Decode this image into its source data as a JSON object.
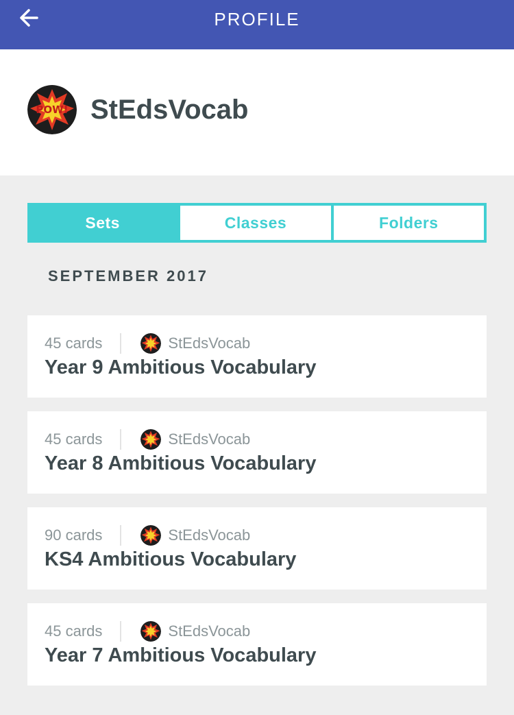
{
  "header": {
    "title": "PROFILE",
    "back_icon": "arrow-left-icon"
  },
  "profile": {
    "username": "StEdsVocab",
    "avatar_icon": "pow-comic-avatar",
    "avatar_text": "POW!"
  },
  "tabs": [
    {
      "label": "Sets",
      "active": true
    },
    {
      "label": "Classes",
      "active": false
    },
    {
      "label": "Folders",
      "active": false
    }
  ],
  "section": {
    "heading": "SEPTEMBER 2017"
  },
  "sets": [
    {
      "count": "45 cards",
      "creator": "StEdsVocab",
      "title": "Year 9 Ambitious Vocabulary"
    },
    {
      "count": "45 cards",
      "creator": "StEdsVocab",
      "title": "Year 8 Ambitious Vocabulary"
    },
    {
      "count": "90 cards",
      "creator": "StEdsVocab",
      "title": "KS4 Ambitious Vocabulary"
    },
    {
      "count": "45 cards",
      "creator": "StEdsVocab",
      "title": "Year 7 Ambitious Vocabulary"
    }
  ],
  "colors": {
    "header_bg": "#4356b3",
    "accent": "#41cfd2",
    "page_bg": "#eeeeee",
    "text_dark": "#3f4b4f",
    "text_muted": "#8b9598"
  }
}
